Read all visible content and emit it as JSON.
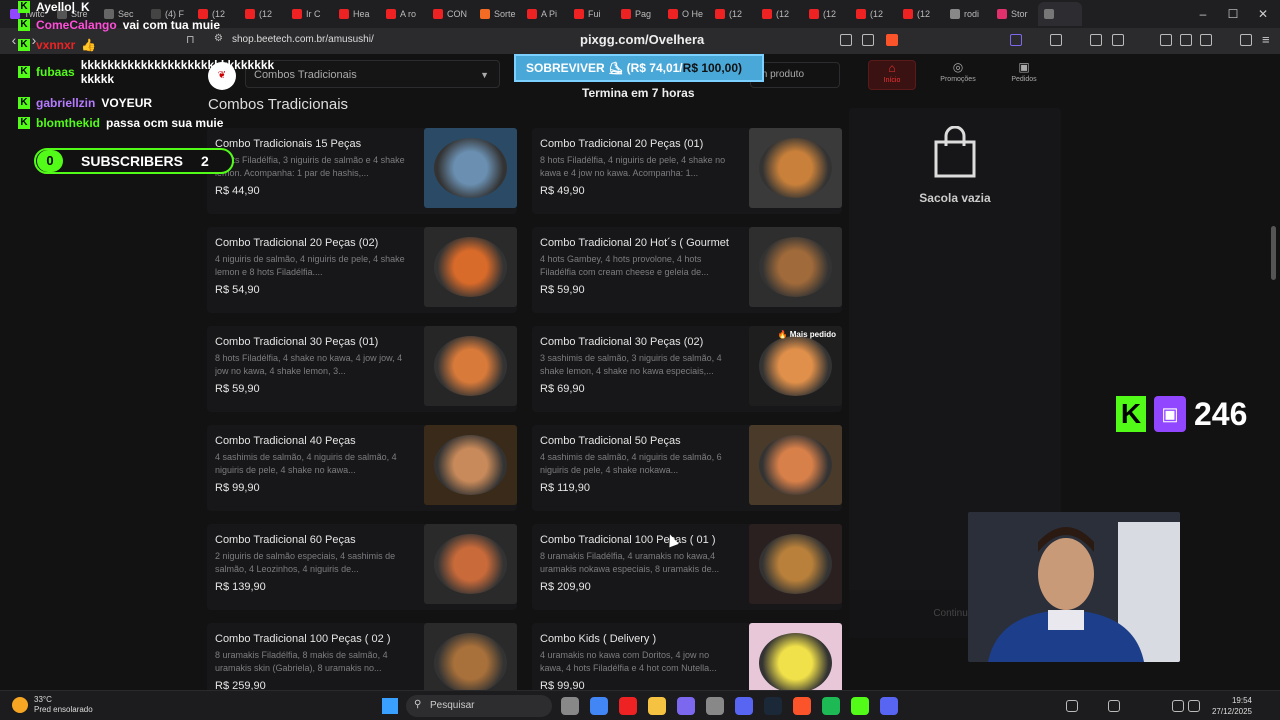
{
  "browser": {
    "tabs": [
      "Twitc",
      "Stre",
      "Sec",
      "(4) F",
      "(12",
      "(12",
      "Ir C",
      "Hea",
      "A ro",
      "CON",
      "Sorte",
      "A Pi",
      "Fui",
      "Pag",
      "O He",
      "(12",
      "(12",
      "(12",
      "(12",
      "(12",
      "rodi",
      "Stor",
      ""
    ],
    "tab_colors": [
      "#9146ff",
      "#555",
      "#666",
      "#444",
      "#e22",
      "#e22",
      "#e22",
      "#e22",
      "#e22",
      "#e22",
      "#f46c24",
      "#e22",
      "#e22",
      "#e22",
      "#e22",
      "#e22",
      "#e22",
      "#e22",
      "#e22",
      "#e22",
      "#888",
      "#e1306c",
      "#777"
    ],
    "url": "shop.beetech.com.br/amusushi/",
    "window_controls": [
      "–",
      "☐",
      "✕"
    ]
  },
  "page": {
    "category_select": "Combos Tradicionais",
    "search_placeholder": "m produto",
    "nav": [
      {
        "label": "Início",
        "icon": "⌂"
      },
      {
        "label": "Promoções",
        "icon": "◎"
      },
      {
        "label": "Pedidos",
        "icon": "▣"
      }
    ],
    "section_title": "Combos Tradicionais",
    "products": [
      {
        "name": "Combo Tradicionais 15 Peças",
        "desc": "4 hots Filadélfia, 3 niguiris de salmão e 4 shake lemon. Acompanha: 1 par de hashis,...",
        "price": "R$ 44,90",
        "color": "#2a4a66",
        "plate": "#6a8fb0"
      },
      {
        "name": "Combo Tradicional 20 Peças (01)",
        "desc": "8 hots Filadélfia, 4 niguiris de pele, 4 shake no kawa e 4 jow no kawa. Acompanha: 1...",
        "price": "R$ 49,90",
        "color": "#3a3a3a",
        "plate": "#c8803a"
      },
      {
        "name": "Combo Tradicional 20 Peças (02)",
        "desc": "4 niguiris de salmão, 4 niguiris de pele, 4 shake lemon e 8 hots Filadélfia....",
        "price": "R$ 54,90",
        "color": "#2a2a2a",
        "plate": "#d86a2a"
      },
      {
        "name": "Combo Tradicional 20 Hot´s ( Gourmet )",
        "desc": "4 hots Gambey, 4 hots provolone, 4 hots Filadélfia com cream cheese e geleia de...",
        "price": "R$ 59,90",
        "color": "#2e2e2e",
        "plate": "#a06a3a"
      },
      {
        "name": "Combo Tradicional 30 Peças (01)",
        "desc": "8 hots Filadélfia, 4 shake no kawa, 4 jow jow, 4 jow no kawa, 4 shake lemon, 3...",
        "price": "R$ 59,90",
        "color": "#262626",
        "plate": "#d87a3a"
      },
      {
        "name": "Combo Tradicional 30 Peças (02)",
        "desc": "3 sashimis de salmão, 3 niguiris de salmão, 4 shake lemon, 4 shake no kawa especiais,...",
        "price": "R$ 69,90",
        "color": "#1e1e1e",
        "plate": "#e0904a",
        "badge": "Mais pedido"
      },
      {
        "name": "Combo Tradicional 40 Peças",
        "desc": "4 sashimis de salmão, 4 niguiris de salmão, 4 niguiris de pele, 4 shake no kawa...",
        "price": "R$ 99,90",
        "color": "#3a2a1a",
        "plate": "#c88a5a"
      },
      {
        "name": "Combo Tradicional 50 Peças",
        "desc": "4 sashimis de salmão, 4 niguiris de salmão, 6 niguiris de pele, 4 shake nokawa...",
        "price": "R$ 119,90",
        "color": "#4a3a2a",
        "plate": "#d8804a"
      },
      {
        "name": "Combo Tradicional 60 Peças",
        "desc": "2 niguiris de salmão especiais, 4 sashimis de salmão, 4 Leozinhos, 4 niguiris de...",
        "price": "R$ 139,90",
        "color": "#2a2a2a",
        "plate": "#c86a3a"
      },
      {
        "name": "Combo Tradicional 100 Peças ( 01 )",
        "desc": "8 uramakis Filadélfia, 4 uramakis no kawa,4 uramakis nokawa especiais, 8 uramakis de...",
        "price": "R$ 209,90",
        "color": "#2a2020",
        "plate": "#b8803a"
      },
      {
        "name": "Combo Tradicional 100 Peças ( 02 )",
        "desc": "8 uramakis Filadélfia, 8 makis de salmão, 4 uramakis skin (Gabriela), 8 uramakis no...",
        "price": "R$ 259,90",
        "color": "#2a2a2a",
        "plate": "#a8703a"
      },
      {
        "name": "Combo Kids ( Delivery )",
        "desc": "4 uramakis no kawa com Doritos, 4 jow no kawa, 4 hots Filadélfia e 4 hot com Nutella...",
        "price": "R$ 99,90",
        "color": "#e8c8d8",
        "plate": "#f0e04a"
      }
    ],
    "cart_empty": "Sacola vazia",
    "continue": "Continuar"
  },
  "overlay": {
    "chat": [
      {
        "user": "Ayello|",
        "msg": "K",
        "color": "#fff"
      },
      {
        "user": "ComeCalango",
        "msg": "vai com tua muie",
        "color": "#ff4fd8"
      },
      {
        "user": "vxnnxr",
        "msg": "👍",
        "color": "#e22"
      },
      {
        "user": "fubaas",
        "msg": "kkkkkkkkkkkkkkkkkkkkkkkkkkkkk kkkkk",
        "color": "#53fc18"
      },
      {
        "user": "gabriellzin",
        "msg": "VOYEUR",
        "color": "#b57bff"
      },
      {
        "user": "blomthekid",
        "msg": "passa ocm sua muie",
        "color": "#53fc18"
      }
    ],
    "subscribers": {
      "left": "0",
      "label": "SUBSCRIBERS",
      "right": "2"
    },
    "goal": {
      "label": "SOBREVIVER",
      "current": "(R$ 74,01/",
      "target": "R$ 100,00)",
      "domain": "pixgg.com/Ovelhera",
      "ends": "Termina em 7 horas"
    },
    "viewers": "246"
  },
  "taskbar": {
    "temp": "33°C",
    "weather": "Pred ensolarado",
    "search": "Pesquisar",
    "time": "19:54",
    "date": "27/12/2025",
    "app_colors": [
      "#888",
      "#4285f4",
      "#e22",
      "#f5c242",
      "#7b68ee",
      "#888",
      "#5865f2",
      "#1b2838",
      "#fb542b",
      "#1db954",
      "#53fc18",
      "#5865f2"
    ]
  }
}
